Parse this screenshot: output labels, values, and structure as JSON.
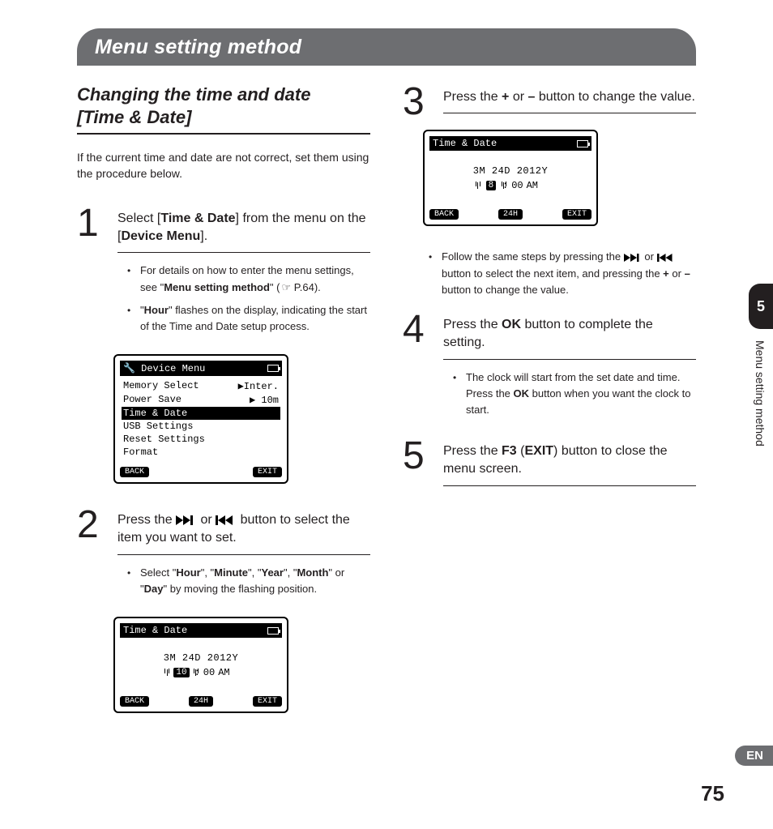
{
  "titleBar": "Menu setting method",
  "sectionTitle": "Changing the time and date\n[Time & Date]",
  "intro": "If the current time and date are not correct, set them using the procedure below.",
  "steps": {
    "s1": {
      "num": "1",
      "text_pre": "Select [",
      "text_b1": "Time & Date",
      "text_mid": "] from the menu on the [",
      "text_b2": "Device Menu",
      "text_post": "].",
      "bullets": {
        "b1_pre": "For details on how to enter the menu settings, see \"",
        "b1_b": "Menu setting method",
        "b1_post": "\" (",
        "b1_ref": "☞ P.64",
        "b1_end": ").",
        "b2_pre": "\"",
        "b2_b": "Hour",
        "b2_post": "\" flashes on the display, indicating the start of the Time and Date setup process."
      }
    },
    "s2": {
      "num": "2",
      "text_pre": "Press the ",
      "text_mid": " or ",
      "text_post": " button to select the item you want to set.",
      "bullet_pre": "Select \"",
      "bullet_items": [
        "Hour",
        "Minute",
        "Year",
        "Month",
        "Day"
      ],
      "bullet_post": "\" by moving the flashing position."
    },
    "s3": {
      "num": "3",
      "text_pre": "Press the ",
      "plus": "+",
      "text_mid": " or ",
      "minus": "–",
      "text_post": " button to change the value.",
      "bullet_pre": "Follow the same steps by pressing the ",
      "bullet_mid1": " or ",
      "bullet_mid2": " button to select the next item, and pressing the ",
      "bullet_mid3": " or ",
      "bullet_post": " button to change the value."
    },
    "s4": {
      "num": "4",
      "text_pre": "Press the ",
      "ok": "OK",
      "text_post": " button to complete the setting.",
      "bullet_pre": "The clock will start from the set date and time. Press the ",
      "bullet_post": " button when you want the clock to start."
    },
    "s5": {
      "num": "5",
      "text_pre": "Press the ",
      "f3": "F3",
      "text_mid": " (",
      "exit": "EXIT",
      "text_post": ") button to close the menu screen."
    }
  },
  "lcd1": {
    "header": "Device Menu",
    "rows": [
      {
        "l": "Memory Select",
        "r": "▶Inter."
      },
      {
        "l": "Power Save",
        "r": "▶ 10m"
      },
      {
        "l": "Time & Date",
        "r": ""
      },
      {
        "l": "USB Settings",
        "r": ""
      },
      {
        "l": "Reset Settings",
        "r": ""
      },
      {
        "l": "Format",
        "r": ""
      }
    ],
    "selectedIndex": 2,
    "softkeys": {
      "left": "BACK",
      "mid": "",
      "right": "EXIT"
    }
  },
  "lcd2": {
    "header": "Time & Date",
    "dateLine": {
      "m": "3M",
      "d": "24D",
      "y": "2012Y"
    },
    "timeLine": {
      "h": "10",
      "m": "00",
      "ampm": "AM"
    },
    "flashField": "h",
    "softkeys": {
      "left": "BACK",
      "mid": "24H",
      "right": "EXIT"
    }
  },
  "lcd3": {
    "header": "Time & Date",
    "dateLine": {
      "m": "3M",
      "d": "24D",
      "y": "2012Y"
    },
    "timeLine": {
      "h": "8",
      "m": "00",
      "ampm": "AM"
    },
    "flashField": "h",
    "softkeys": {
      "left": "BACK",
      "mid": "24H",
      "right": "EXIT"
    }
  },
  "side": {
    "chapter": "5",
    "label": "Menu setting method"
  },
  "lang": "EN",
  "pageNum": "75"
}
